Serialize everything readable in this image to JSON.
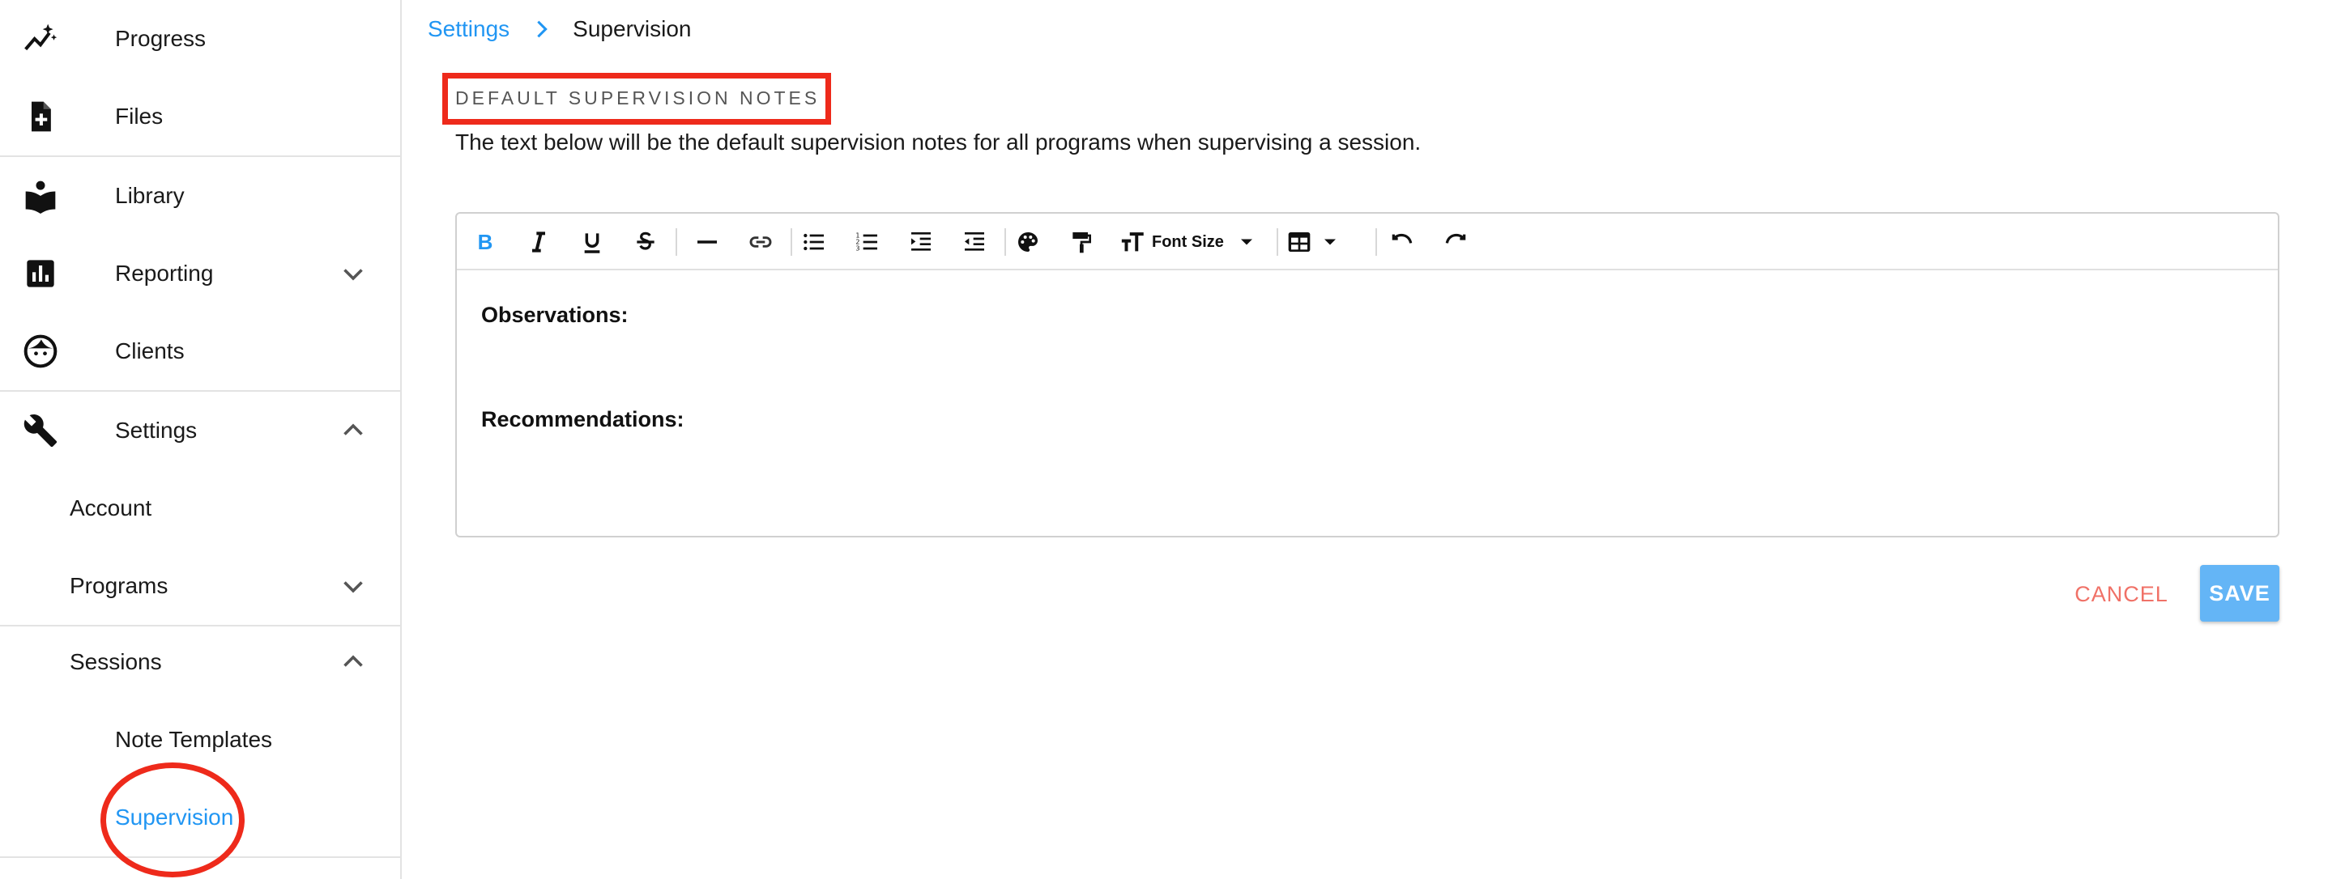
{
  "sidebar": {
    "items": [
      {
        "label": "Progress",
        "icon": "progress-sparkle-icon"
      },
      {
        "label": "Files",
        "icon": "file-add-icon"
      },
      {
        "label": "Library",
        "icon": "library-book-icon"
      },
      {
        "label": "Reporting",
        "icon": "bar-chart-icon",
        "expanded": false
      },
      {
        "label": "Clients",
        "icon": "face-icon"
      },
      {
        "label": "Settings",
        "icon": "wrench-icon",
        "expanded": true
      },
      {
        "label": "Account"
      },
      {
        "label": "Programs",
        "expanded": false
      },
      {
        "label": "Sessions",
        "expanded": true
      },
      {
        "label": "Note Templates"
      },
      {
        "label": "Supervision",
        "active": true
      }
    ]
  },
  "breadcrumb": {
    "parent": "Settings",
    "current": "Supervision"
  },
  "section": {
    "title": "DEFAULT SUPERVISION NOTES",
    "description": "The text below will be the default supervision notes for all programs when supervising a session."
  },
  "editor": {
    "toolbar": {
      "bold": "B",
      "font_size_label": "Font Size"
    },
    "content": {
      "line1": "Observations:",
      "line2": "Recommendations:"
    }
  },
  "actions": {
    "cancel_label": "CANCEL",
    "save_label": "SAVE"
  },
  "colors": {
    "accent": "#2196f3",
    "annotation_red": "#ee2a1b",
    "cancel": "#f07167",
    "save_bg": "#64b5f6"
  }
}
